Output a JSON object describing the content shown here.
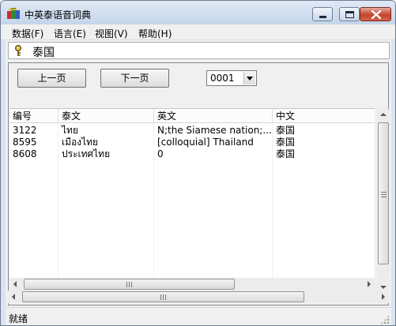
{
  "window": {
    "title": "中英泰语音词典"
  },
  "menu": [
    {
      "label": "数据(F)"
    },
    {
      "label": "语言(E)"
    },
    {
      "label": "视图(V)"
    },
    {
      "label": "帮助(H)"
    }
  ],
  "search": {
    "word": "泰国"
  },
  "toolbar": {
    "prev_label": "上一页",
    "next_label": "下一页",
    "page_select": "0001"
  },
  "table": {
    "columns": [
      "编号",
      "泰文",
      "英文",
      "中文"
    ],
    "rows": [
      [
        "3122",
        "ไทย",
        " N;the Siamese nation;...",
        "泰国"
      ],
      [
        "8595",
        "เมืองไทย",
        "[colloquial] Thailand",
        "泰国"
      ],
      [
        "8608",
        "ประเทศไทย",
        "0",
        "泰国"
      ]
    ]
  },
  "status": {
    "text": "就绪"
  },
  "colors": {
    "title_gradient_top": "#dfe9f5",
    "close_button": "#c5432d",
    "face": "#f0f0f0"
  }
}
